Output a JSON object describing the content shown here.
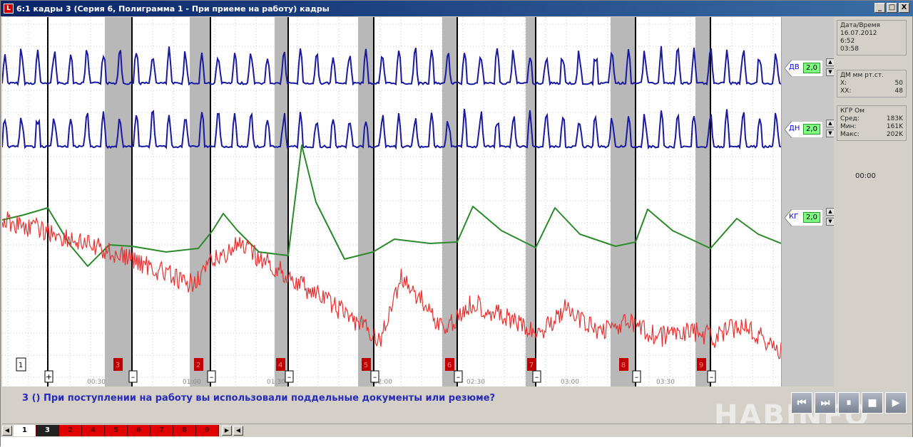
{
  "window": {
    "title": "6:1  кадры 3 (Серия 6, Полиграмма 1 - При приеме на работу) кадры",
    "controls": [
      "_",
      "□",
      "X"
    ]
  },
  "channels": [
    {
      "label": "ДВ",
      "value": "2,0"
    },
    {
      "label": "ДН",
      "value": "2,0"
    },
    {
      "label": "КГ",
      "value": "2,0"
    }
  ],
  "info": {
    "datetime": {
      "title": "Дата/Время",
      "date": "16.07.2012",
      "time": "6:52",
      "duration": "03:58"
    },
    "pressure": {
      "title": "ДМ мм рт.ст.",
      "rows": [
        {
          "k": "Х:",
          "v": "50"
        },
        {
          "k": "ХХ:",
          "v": "48"
        }
      ]
    },
    "gsr": {
      "title": "КГР Ом",
      "rows": [
        {
          "k": "Сред:",
          "v": "183K"
        },
        {
          "k": "Мин:",
          "v": "161K"
        },
        {
          "k": "Макс:",
          "v": "202K"
        }
      ]
    },
    "timer": "00:00"
  },
  "plot": {
    "question_markers": [
      {
        "label": "1",
        "style": "box"
      },
      {
        "label": "3",
        "style": "red"
      },
      {
        "label": "2",
        "style": "red"
      },
      {
        "label": "4",
        "style": "red"
      },
      {
        "label": "5",
        "style": "red"
      },
      {
        "label": "6",
        "style": "red"
      },
      {
        "label": "7",
        "style": "red"
      },
      {
        "label": "8",
        "style": "red"
      },
      {
        "label": "9",
        "style": "red"
      }
    ],
    "answer_marks": [
      "+",
      "–",
      "–",
      "–",
      "–",
      "–",
      "–",
      "–",
      "–"
    ],
    "time_labels": [
      "00:30",
      "01:00",
      "01:30",
      "02:00",
      "02:30",
      "03:00",
      "03:30"
    ]
  },
  "question": {
    "text": "3 () При поступлении на работу вы использовали поддельные документы или резюме?"
  },
  "transport": {
    "buttons": [
      {
        "name": "rewind-start-button",
        "glyph": "⏮"
      },
      {
        "name": "fast-forward-button",
        "glyph": "⏭"
      },
      {
        "name": "pause-button",
        "glyph": "⏸"
      },
      {
        "name": "stop-button",
        "glyph": "■"
      },
      {
        "name": "play-button",
        "glyph": "▶"
      }
    ]
  },
  "watermark": "HABINFO",
  "question_tabs": [
    {
      "label": "1",
      "state": "inactive"
    },
    {
      "label": "3",
      "state": "current"
    },
    {
      "label": "2",
      "state": "asked"
    },
    {
      "label": "4",
      "state": "asked"
    },
    {
      "label": "5",
      "state": "asked"
    },
    {
      "label": "6",
      "state": "asked"
    },
    {
      "label": "7",
      "state": "asked"
    },
    {
      "label": "8",
      "state": "asked"
    },
    {
      "label": "9",
      "state": "asked"
    }
  ],
  "colors": {
    "breathing_upper": "#1a1aa0",
    "breathing_lower": "#1a1aa0",
    "gsr": "#2a8a2a",
    "cardio": "#e83030",
    "marker_red": "#c00000",
    "interval_band": "#b8b8b8"
  }
}
